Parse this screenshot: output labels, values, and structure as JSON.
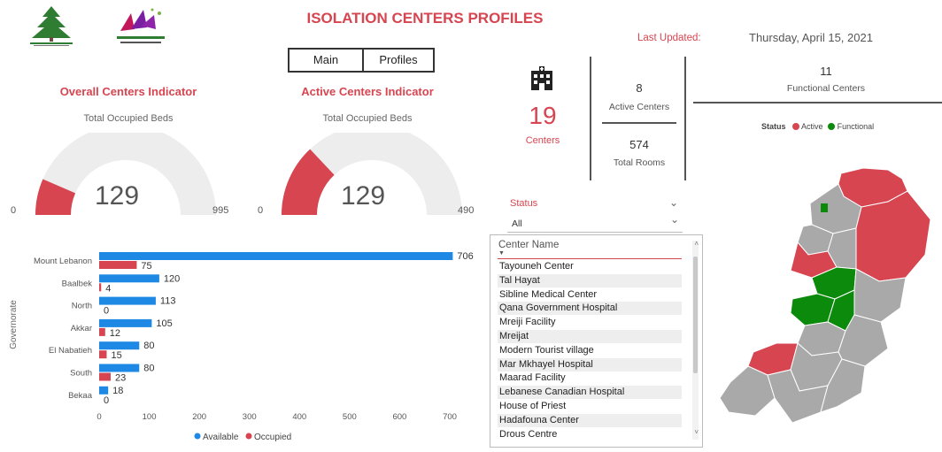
{
  "header": {
    "title": "ISOLATION CENTERS PROFILES",
    "last_updated_label": "Last Updated:",
    "last_updated_value": "Thursday, April 15, 2021",
    "nav": {
      "main_label": "Main",
      "profiles_label": "Profiles"
    }
  },
  "gauges": {
    "overall": {
      "title": "Overall Centers Indicator",
      "subtitle": "Total Occupied Beds",
      "value": "129",
      "min": "0",
      "max": "995",
      "fill_fraction": 0.13
    },
    "active": {
      "title": "Active Centers Indicator",
      "subtitle": "Total Occupied Beds",
      "value": "129",
      "min": "0",
      "max": "490",
      "fill_fraction": 0.26
    }
  },
  "kpis": {
    "centers_value": "19",
    "centers_label": "Centers",
    "active_value": "8",
    "active_label": "Active Centers",
    "rooms_value": "574",
    "rooms_label": "Total Rooms",
    "functional_value": "11",
    "functional_label": "Functional Centers",
    "building_icon": "hospital-building-icon"
  },
  "map_legend": {
    "title": "Status",
    "items": [
      {
        "label": "Active",
        "color": "#d64550"
      },
      {
        "label": "Functional",
        "color": "#0c8a0c"
      }
    ]
  },
  "filter": {
    "label": "Status",
    "value": "All"
  },
  "center_list": {
    "header": "Center Name",
    "items": [
      "Tayouneh Center",
      "Tal Hayat",
      "Sibline Medical Center",
      "Qana Government Hospital",
      "Mreiji Facility",
      "Mreijat",
      "Modern Tourist village",
      "Mar Mkhayel Hospital",
      "Maarad Facility",
      "Lebanese Canadian Hospital",
      "House of Priest",
      "Hadafouna Center",
      "Drous Centre"
    ]
  },
  "colors": {
    "available": "#1e88e5",
    "occupied": "#d64550",
    "functional": "#0c8a0c",
    "inactive_region": "#a9a9a9"
  },
  "chart_data": {
    "type": "bar",
    "orientation": "horizontal",
    "ylabel": "Governorate",
    "categories": [
      "Mount Lebanon",
      "Baalbek",
      "North",
      "Akkar",
      "El Nabatieh",
      "South",
      "Bekaa"
    ],
    "series": [
      {
        "name": "Available",
        "values": [
          706,
          120,
          113,
          105,
          80,
          80,
          18
        ]
      },
      {
        "name": "Occupied",
        "values": [
          75,
          4,
          0,
          12,
          15,
          23,
          0
        ]
      }
    ],
    "xlim": [
      0,
      700
    ],
    "xticks": [
      0,
      100,
      200,
      300,
      400,
      500,
      600,
      700
    ],
    "legend": "bottom"
  }
}
